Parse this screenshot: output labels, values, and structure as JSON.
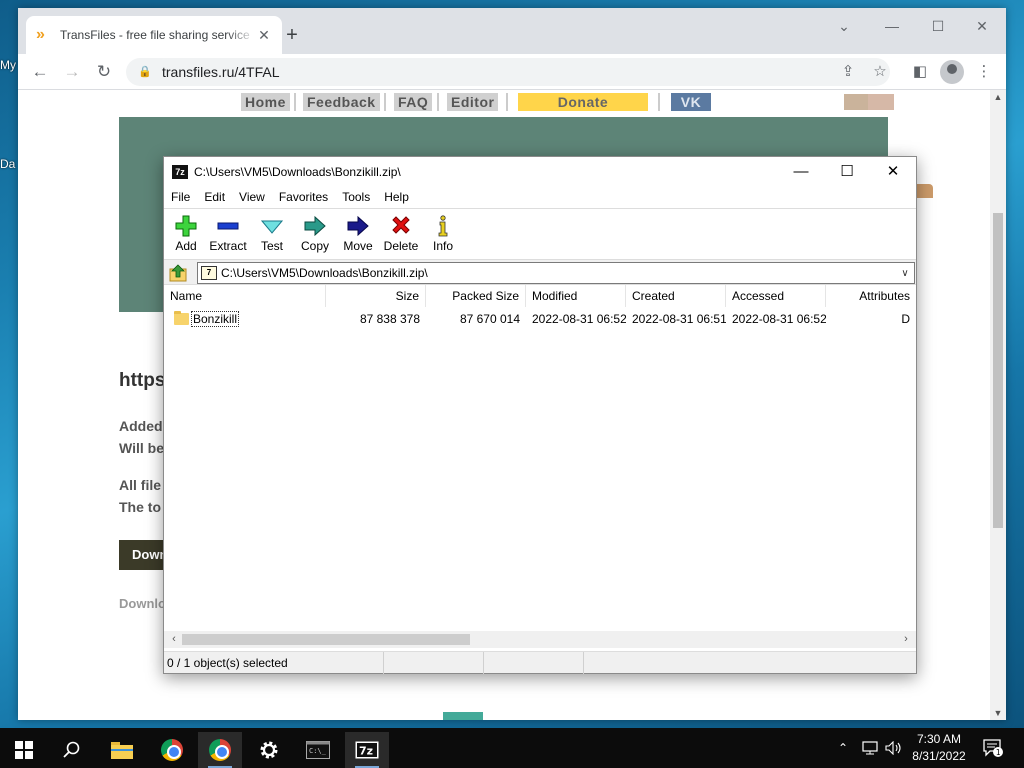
{
  "desktop": {
    "frag1": "My",
    "frag2": "Da"
  },
  "browser": {
    "tab_title": "TransFiles - free file sharing service",
    "tab_close": "✕",
    "new_tab": "+",
    "url": "transfiles.ru/4TFAL",
    "nav": {
      "home": "Home",
      "feedback": "Feedback",
      "faq": "FAQ",
      "editor": "Editor",
      "donate": "Donate",
      "vk": "VK"
    },
    "page": {
      "heading": "https",
      "added": "Added",
      "will_be": "Will be",
      "all_files": "All file",
      "the_to": "The to",
      "download_btn": "Down",
      "download_link": "Downlo"
    }
  },
  "sevenzip": {
    "title": "C:\\Users\\VM5\\Downloads\\Bonzikill.zip\\",
    "menu": [
      "File",
      "Edit",
      "View",
      "Favorites",
      "Tools",
      "Help"
    ],
    "toolbar": {
      "add": "Add",
      "extract": "Extract",
      "test": "Test",
      "copy": "Copy",
      "move": "Move",
      "delete": "Delete",
      "info": "Info"
    },
    "address": "C:\\Users\\VM5\\Downloads\\Bonzikill.zip\\",
    "columns": {
      "name": "Name",
      "size": "Size",
      "packed": "Packed Size",
      "modified": "Modified",
      "created": "Created",
      "accessed": "Accessed",
      "attributes": "Attributes"
    },
    "rows": [
      {
        "name": "Bonzikill",
        "size": "87 838 378",
        "packed": "87 670 014",
        "modified": "2022-08-31 06:52",
        "created": "2022-08-31 06:51",
        "accessed": "2022-08-31 06:52",
        "attributes": "D"
      }
    ],
    "status": "0 / 1 object(s) selected"
  },
  "taskbar": {
    "time": "7:30 AM",
    "date": "8/31/2022",
    "notification_count": "1"
  }
}
